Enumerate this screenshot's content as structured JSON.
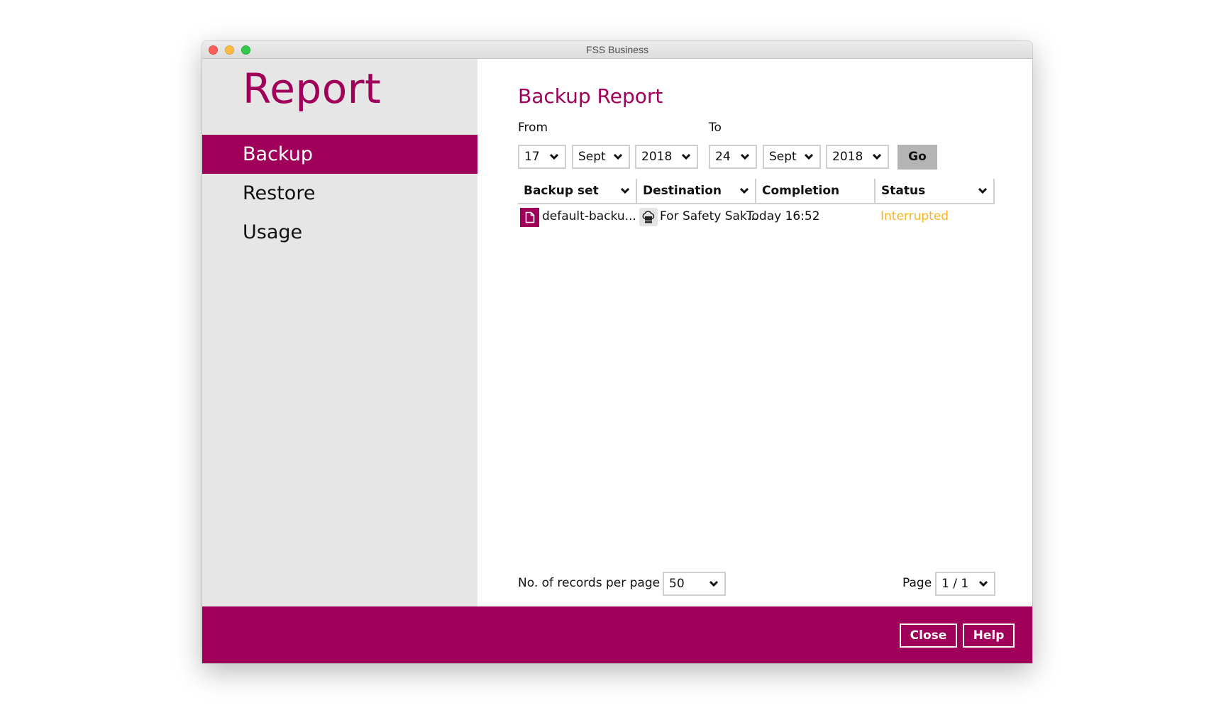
{
  "window": {
    "title": "FSS Business"
  },
  "sidebar": {
    "title": "Report",
    "items": [
      {
        "label": "Backup",
        "active": true
      },
      {
        "label": "Restore",
        "active": false
      },
      {
        "label": "Usage",
        "active": false
      }
    ]
  },
  "main": {
    "heading": "Backup Report",
    "from": {
      "label": "From",
      "day": "17",
      "month": "Sept",
      "year": "2018"
    },
    "to": {
      "label": "To",
      "day": "24",
      "month": "Sept",
      "year": "2018"
    },
    "go_label": "Go",
    "table": {
      "columns": [
        "Backup set",
        "Destination",
        "Completion",
        "Status"
      ],
      "rows": [
        {
          "backup_set": "default-backu...",
          "destination": "For Safety Sak...",
          "completion": "Today 16:52",
          "status": "Interrupted"
        }
      ]
    },
    "records_per_page": {
      "label": "No. of records per page",
      "value": "50"
    },
    "page": {
      "label": "Page",
      "value": "1 / 1"
    }
  },
  "footer": {
    "close_label": "Close",
    "help_label": "Help"
  },
  "colors": {
    "accent": "#a0005a",
    "sidebar_bg": "#e6e6e6",
    "status_interrupted": "#f5b323",
    "go_button": "#b4b4b4"
  },
  "icons": {
    "backup_set": "document-icon",
    "destination": "cloud-storage-icon",
    "dropdown": "chevron-down-icon"
  }
}
